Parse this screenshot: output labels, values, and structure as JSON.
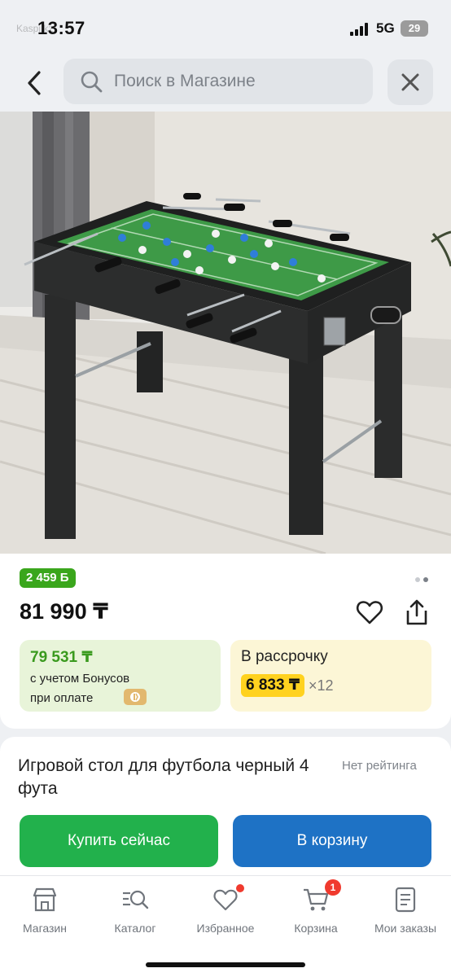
{
  "status_bar": {
    "time": "13:57",
    "previous_app": "Kaspi.kz",
    "network": "5G",
    "battery": "29"
  },
  "search": {
    "placeholder": "Поиск в Магазине"
  },
  "icons": {
    "back": "chevron-left-icon",
    "search": "search-icon",
    "close": "close-icon",
    "favorite": "heart-icon",
    "share": "share-icon"
  },
  "product": {
    "image_alt": "Игровой стол для футбола черный 4 фута",
    "bonus_badge": "2 459 Б",
    "price": "81 990 ₸",
    "bonus_price": {
      "amount": "79 531 ₸",
      "line1": "с учетом Бонусов",
      "line2": "при оплате"
    },
    "installment": {
      "title": "В рассрочку",
      "monthly": "6 833 ₸",
      "multiplier": "×12"
    },
    "name": "Игровой стол для футбола черный 4 фута",
    "rating": "Нет рейтинга",
    "buy_now_label": "Купить сейчас",
    "add_to_cart_label": "В корзину",
    "image_pages": 2,
    "image_active_page": 2
  },
  "nav": {
    "items": [
      {
        "label": "Магазин",
        "icon": "store-icon"
      },
      {
        "label": "Каталог",
        "icon": "catalog-search-icon"
      },
      {
        "label": "Избранное",
        "icon": "heart-icon"
      },
      {
        "label": "Корзина",
        "icon": "cart-icon",
        "badge": "1"
      },
      {
        "label": "Мои заказы",
        "icon": "orders-icon"
      }
    ]
  },
  "colors": {
    "green_button": "#22b14c",
    "blue_button": "#1e72c5",
    "bonus_green": "#3a9a1e",
    "installment_yellow": "#ffd21f",
    "badge_red": "#f03a2e"
  }
}
